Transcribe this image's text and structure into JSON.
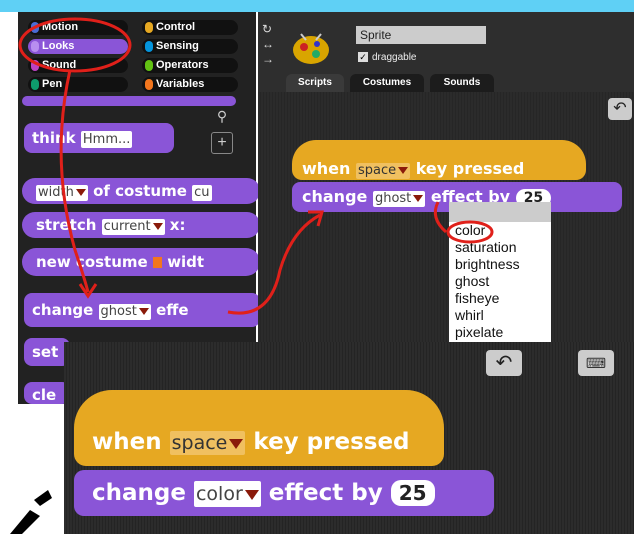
{
  "categories": {
    "left": [
      {
        "label": "Motion",
        "color": "#4a6cd4"
      },
      {
        "label": "Looks",
        "color": "#8a55d7"
      },
      {
        "label": "Sound",
        "color": "#bb42c3"
      },
      {
        "label": "Pen",
        "color": "#0e9a6c"
      }
    ],
    "right": [
      {
        "label": "Control",
        "color": "#e6a822"
      },
      {
        "label": "Sensing",
        "color": "#0494dc"
      },
      {
        "label": "Operators",
        "color": "#62c213"
      },
      {
        "label": "Variables",
        "color": "#f3761d"
      }
    ]
  },
  "palette": {
    "think_label": "think",
    "think_value": "Hmm...",
    "width_label": "width",
    "of_costume_label": "of costume",
    "width_slot": "cu",
    "stretch_label": "stretch",
    "stretch_slot": "current",
    "x_label": "x:",
    "new_costume_label": "new costume",
    "new_costume_suffix": "widt",
    "change_label": "change",
    "change_slot": "ghost",
    "change_suffix": "effe",
    "set_label": "set",
    "clear_label": "cle"
  },
  "sprite": {
    "name": "Sprite",
    "draggable_label": "draggable"
  },
  "tabs": [
    "Scripts",
    "Costumes",
    "Sounds"
  ],
  "script": {
    "when_label": "when",
    "key_slot": "space",
    "key_pressed": "key pressed",
    "change_label": "change",
    "effect_slot": "ghost",
    "effect_by": "effect by",
    "amount": "25"
  },
  "effect_menu": {
    "options": [
      "color",
      "saturation",
      "brightness",
      "ghost",
      "fisheye",
      "whirl",
      "pixelate"
    ],
    "selected": "color"
  },
  "zoomed": {
    "when_label": "when",
    "key_slot": "space",
    "key_pressed": "key pressed",
    "change_label": "change",
    "effect_slot": "color",
    "effect_by": "effect by",
    "amount": "25"
  },
  "colors": {
    "looks": "#8a55d7",
    "control": "#e6a822",
    "annotation": "#e0201a"
  }
}
